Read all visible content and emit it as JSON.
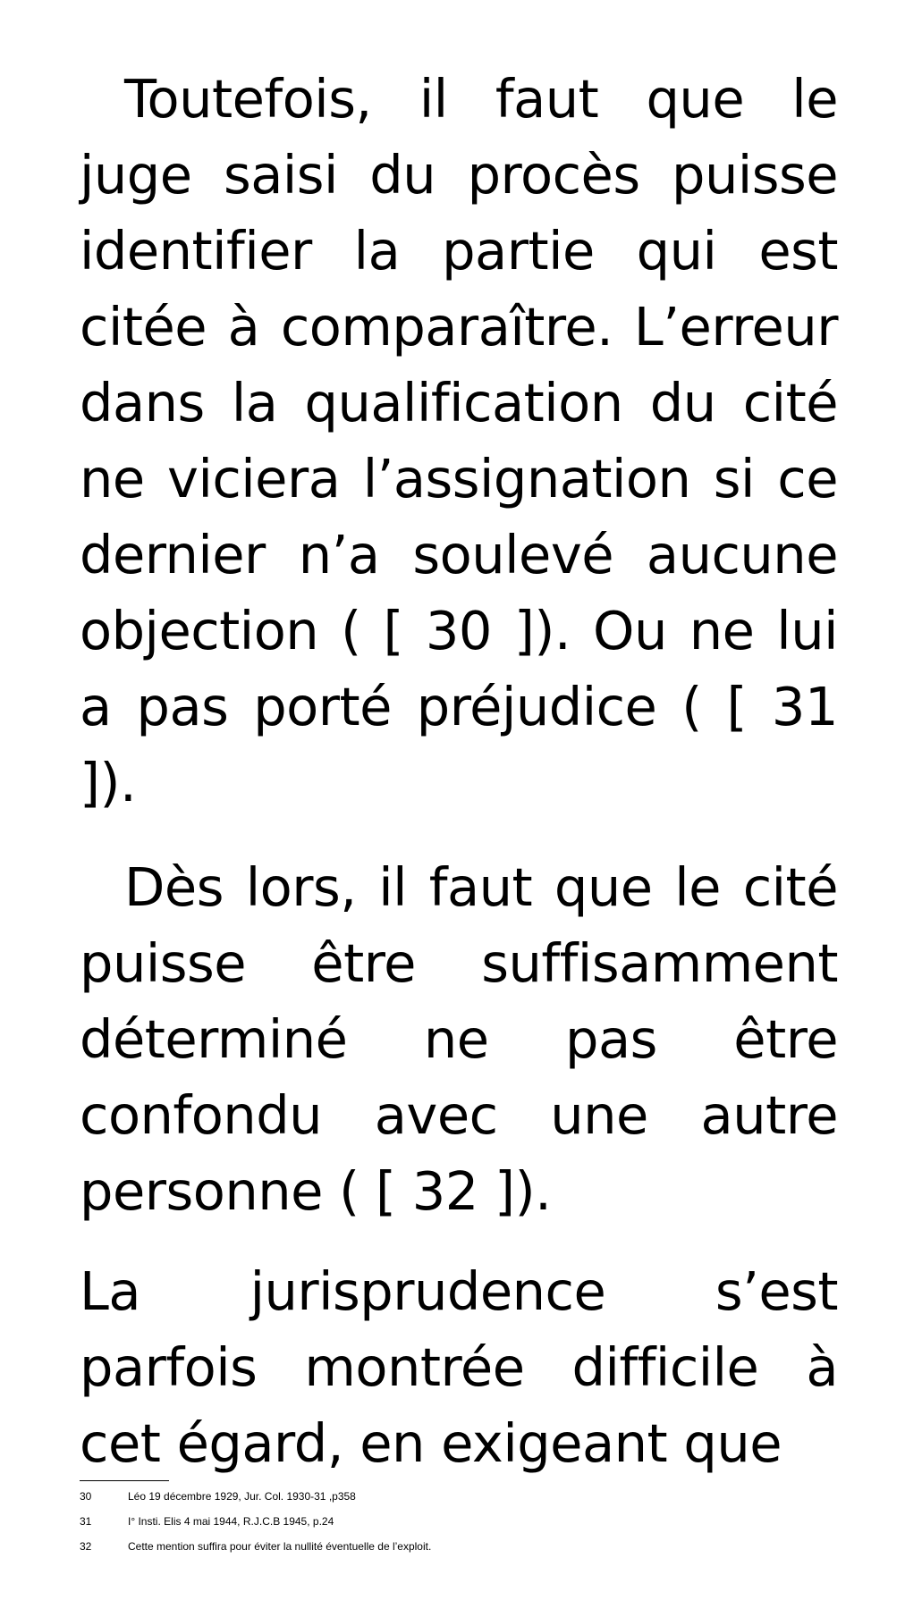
{
  "paragraphs": [
    {
      "text": "Toutefois, il faut que le juge saisi du procès puisse identifier la partie qui est citée à comparaître. L’erreur dans la qualification du cité ne viciera l’assignation si ce dernier n’a soulevé aucune objection ( [ 30 ]). Ou ne lui a pas porté préjudice ( [ 31 ])."
    },
    {
      "text": "Dès lors, il faut que le cité puisse être suffisamment déterminé ne pas être confondu avec une autre personne ( [ 32 ])."
    },
    {
      "text": "La jurisprudence s’est parfois montrée difficile à cet égard, en exigeant que"
    }
  ],
  "footnotes": [
    {
      "number": "30",
      "text": "Léo 19 décembre 1929, Jur. Col. 1930-31 ,p358"
    },
    {
      "number": "31",
      "text": "I° Insti. Elis 4 mai 1944, R.J.C.B 1945, p.24"
    },
    {
      "number": "32",
      "text": "Cette mention suffira pour éviter la nullité éventuelle de l’exploit."
    }
  ]
}
